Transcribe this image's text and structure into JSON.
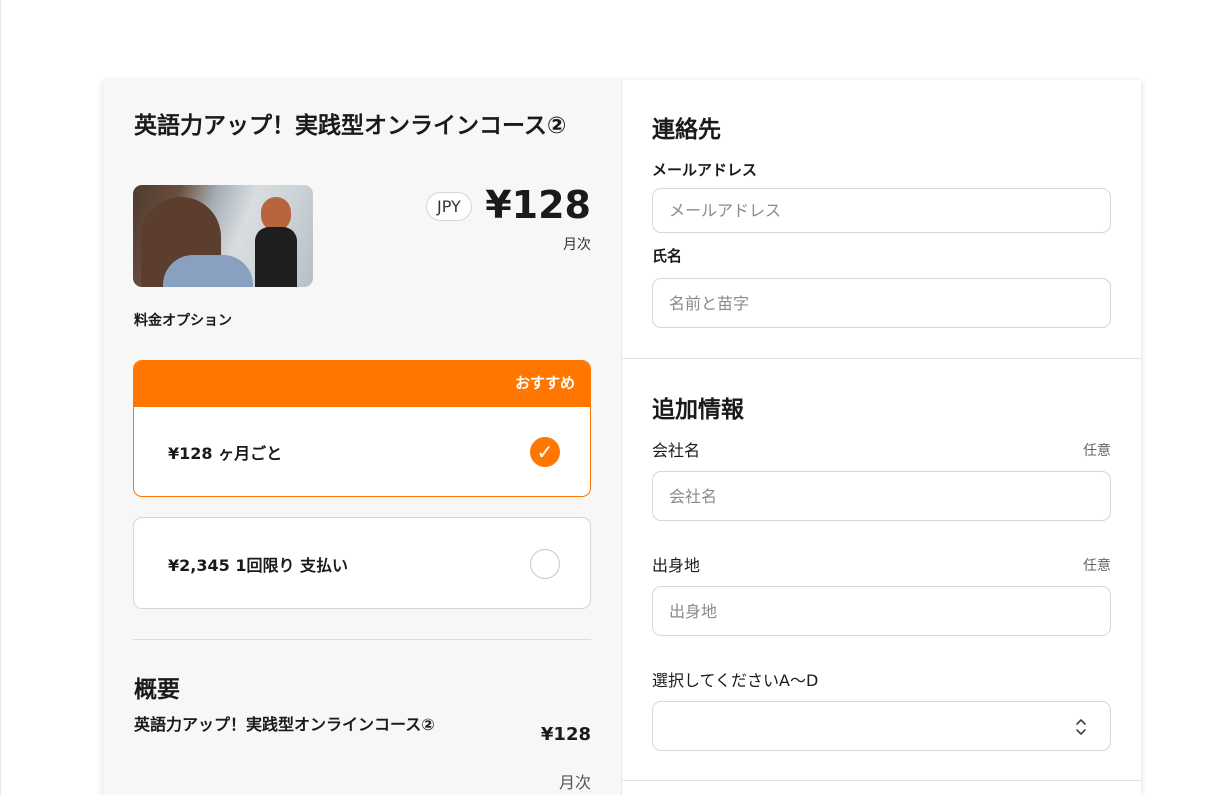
{
  "product": {
    "title": "英語力アップ！実践型オンラインコース②",
    "currency": "JPY",
    "price": "¥128",
    "period": "月次"
  },
  "pricing": {
    "label": "料金オプション",
    "recommended_badge": "おすすめ",
    "options": [
      {
        "label": "¥128 ヶ月ごと",
        "selected": true
      },
      {
        "label": "¥2,345 1回限り 支払い",
        "selected": false
      }
    ]
  },
  "summary": {
    "title": "概要",
    "item_name": "英語力アップ！実践型オンラインコース②",
    "item_price": "¥128",
    "item_period": "月次"
  },
  "contact": {
    "title": "連絡先",
    "email_label": "メールアドレス",
    "email_placeholder": "メールアドレス",
    "name_label": "氏名",
    "name_placeholder": "名前と苗字"
  },
  "additional": {
    "title": "追加情報",
    "optional_tag": "任意",
    "company_label": "会社名",
    "company_placeholder": "会社名",
    "hometown_label": "出身地",
    "hometown_placeholder": "出身地",
    "select_label": "選択してくださいA〜D"
  },
  "colors": {
    "accent": "#ff7700"
  }
}
